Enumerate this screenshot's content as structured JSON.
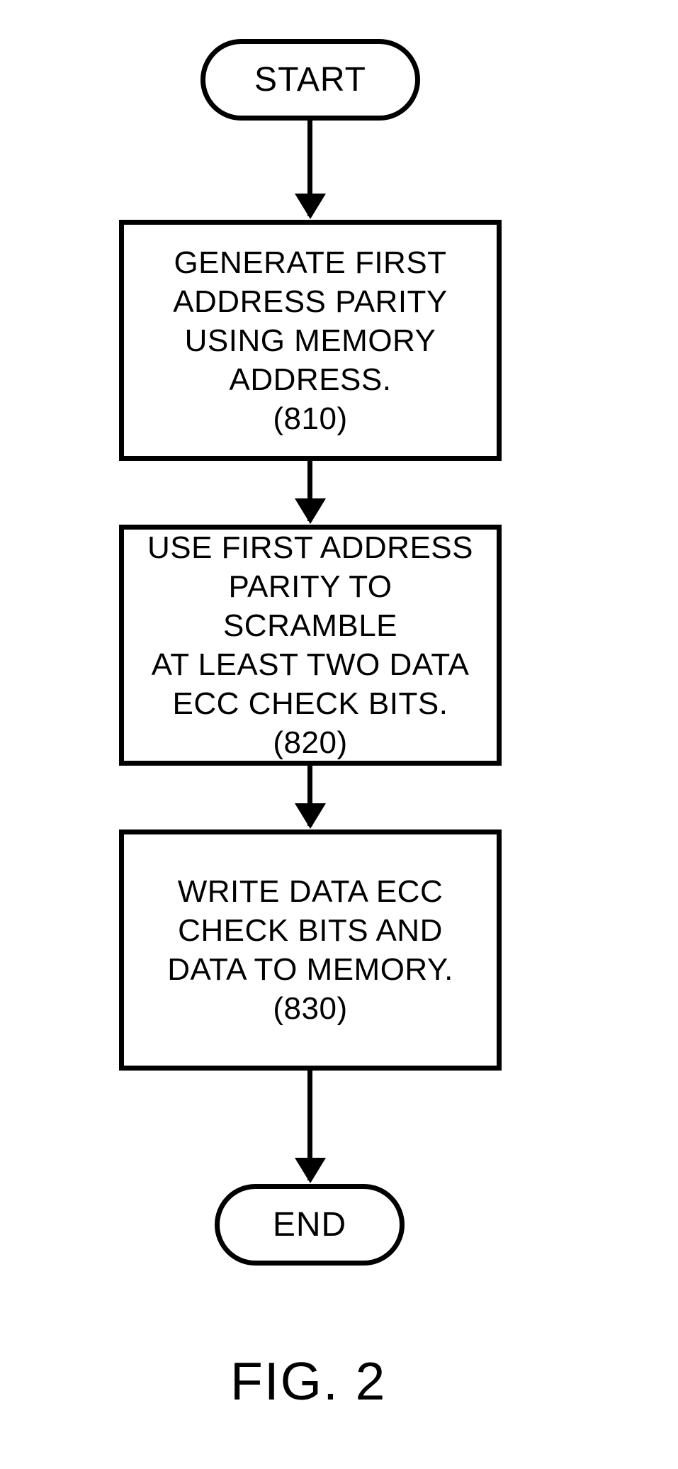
{
  "flow": {
    "start": "START",
    "end": "END",
    "steps": [
      {
        "text": "GENERATE FIRST\nADDRESS PARITY\nUSING MEMORY\nADDRESS.\n(810)",
        "ref": "810"
      },
      {
        "text": "USE FIRST ADDRESS\nPARITY TO SCRAMBLE\nAT LEAST TWO DATA\nECC CHECK BITS.\n(820)",
        "ref": "820"
      },
      {
        "text": "WRITE DATA ECC\nCHECK BITS AND\nDATA TO MEMORY.\n(830)",
        "ref": "830"
      }
    ]
  },
  "caption": "FIG. 2"
}
